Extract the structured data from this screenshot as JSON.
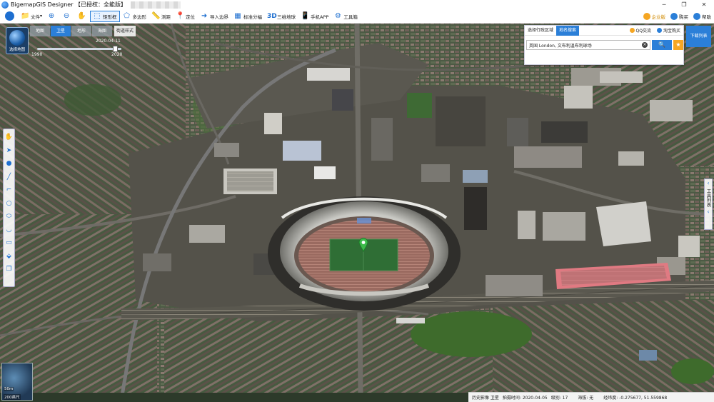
{
  "titlebar": {
    "title": "BigemapGIS Designer 【已授权：全能版】",
    "minimize": "─",
    "maximize": "❐",
    "close": "✕"
  },
  "toolbar": {
    "items": [
      {
        "label": "文件",
        "icon": "folder-icon",
        "glyph": "📁"
      },
      {
        "label": "",
        "icon": "zoom-in-icon",
        "glyph": "⊕"
      },
      {
        "label": "",
        "icon": "zoom-out-icon",
        "glyph": "⊖"
      },
      {
        "label": "",
        "icon": "pan-hand-icon",
        "glyph": "✋"
      },
      {
        "label": "矩形框",
        "icon": "rectangle-select-icon",
        "glyph": "⬚",
        "active": true
      },
      {
        "label": "多边形",
        "icon": "polygon-icon",
        "glyph": "⬠"
      },
      {
        "label": "测距",
        "icon": "ruler-icon",
        "glyph": "📏"
      },
      {
        "label": "定位",
        "icon": "locate-pin-icon",
        "glyph": "📍"
      },
      {
        "label": "导入边界",
        "icon": "import-boundary-icon",
        "glyph": "➜"
      },
      {
        "label": "标准分幅",
        "icon": "grid-icon",
        "glyph": "▦"
      },
      {
        "label": "三维地球",
        "icon": "3d-icon",
        "glyph": "3D"
      },
      {
        "label": "手机APP",
        "icon": "phone-icon",
        "glyph": "📱"
      },
      {
        "label": "工具箱",
        "icon": "gear-icon",
        "glyph": "⚙"
      }
    ],
    "right": [
      {
        "label": "企业版",
        "icon": "crown-icon",
        "color": "#f5a623"
      },
      {
        "label": "购买",
        "icon": "cart-icon",
        "color": "#2b7fd8"
      },
      {
        "label": "帮助",
        "icon": "help-icon",
        "color": "#2b7fd8"
      }
    ]
  },
  "map_panel": {
    "logo_label": "选择地图",
    "map_types": [
      {
        "label": "地图",
        "selected": false
      },
      {
        "label": "卫星",
        "selected": true
      },
      {
        "label": "地形",
        "selected": false
      },
      {
        "label": "海图",
        "selected": false
      }
    ],
    "street_style": "街道样式",
    "timeline": {
      "current": "2020-04-11",
      "start": "1990",
      "end": "2020",
      "position": 0.93
    }
  },
  "search": {
    "tabs": [
      {
        "label": "选择行政区域",
        "selected": false
      },
      {
        "label": "地名搜索",
        "selected": true
      }
    ],
    "qq_link": "QQ交流",
    "taobao_link": "淘宝购买",
    "value": "英国 London, 文布利温布利球场",
    "go": "🔍",
    "star": "★"
  },
  "download_button": "下载列表",
  "left_tools": [
    {
      "icon": "hand-icon",
      "glyph": "✋"
    },
    {
      "icon": "pointer-icon",
      "glyph": "➤"
    },
    {
      "icon": "marker-icon",
      "glyph": "●"
    },
    {
      "icon": "line-icon",
      "glyph": "╱"
    },
    {
      "icon": "polyline-icon",
      "glyph": "⌐"
    },
    {
      "icon": "circle-icon",
      "glyph": "○"
    },
    {
      "icon": "ellipse-icon",
      "glyph": "⬭"
    },
    {
      "icon": "arc-icon",
      "glyph": "◡"
    },
    {
      "icon": "rectangle-icon",
      "glyph": "▭"
    },
    {
      "icon": "label-tag-icon",
      "glyph": "⬙"
    },
    {
      "icon": "layers-icon",
      "glyph": "❐"
    }
  ],
  "right_tools": {
    "label": "工具列表",
    "chev_up": "‹",
    "chev_down": "‹"
  },
  "minimap": {
    "scale_top": "50m",
    "scale_bottom": "200英尺"
  },
  "status": {
    "source": "历史影像 卫星",
    "date_label": "拍摄时间: 2020-04-05",
    "level": "级别: 17",
    "altitude": "海拔: 无",
    "coords": "经纬度: -0.275677, 51.559868"
  },
  "colors": {
    "accent": "#2b7fd8",
    "pin": "#3dbb4a",
    "stand_red": "#e24a5a"
  }
}
